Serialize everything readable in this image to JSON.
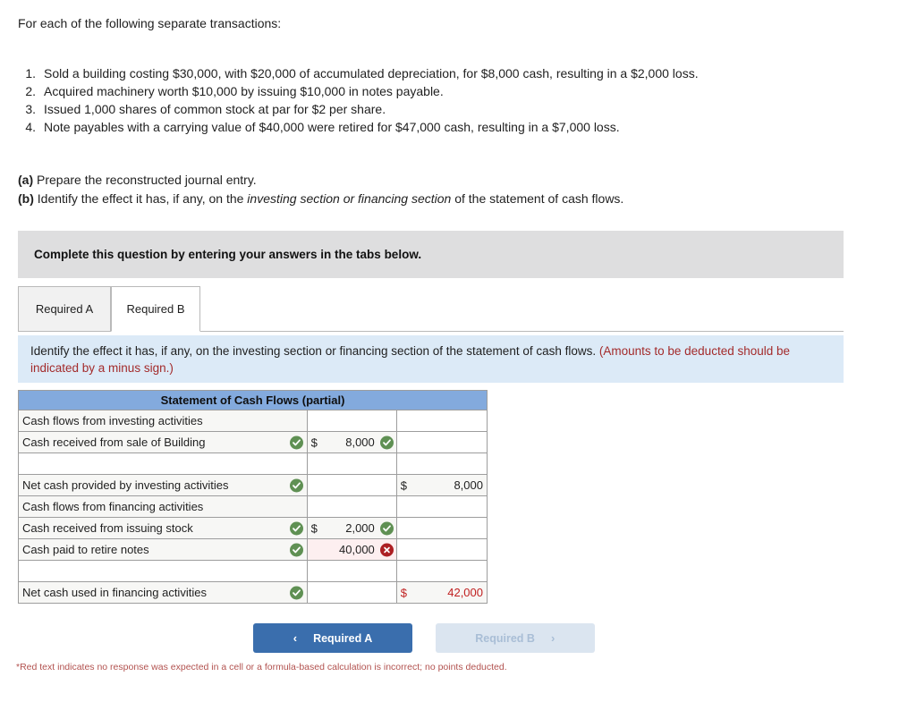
{
  "intro": "For each of the following separate transactions:",
  "transactions": [
    {
      "num": "1.",
      "text": "Sold a building costing $30,000, with $20,000 of accumulated depreciation, for $8,000 cash, resulting in a $2,000 loss."
    },
    {
      "num": "2.",
      "text": "Acquired machinery worth $10,000 by issuing $10,000 in notes payable."
    },
    {
      "num": "3.",
      "text": "Issued 1,000 shares of common stock at par for $2 per share."
    },
    {
      "num": "4.",
      "text": "Note payables with a carrying value of $40,000 were retired for $47,000 cash, resulting in a $7,000 loss."
    }
  ],
  "requirements": {
    "a_label": "(a)",
    "a_text": "Prepare the reconstructed journal entry.",
    "b_label": "(b)",
    "b_text_before": "Identify the effect it has, if any, on the ",
    "b_text_italic": "investing section or financing section",
    "b_text_after": " of the statement of cash flows."
  },
  "banner": {
    "text": "Complete this question by entering your answers in the tabs below."
  },
  "tabs": [
    {
      "label": "Required A",
      "state": "inactive"
    },
    {
      "label": "Required B",
      "state": "active"
    }
  ],
  "instruction_panel": {
    "main": "Identify the effect it has, if any, on the investing section or financing section of the statement of cash flows. ",
    "warning": "(Amounts to be deducted should be indicated by a minus sign.)"
  },
  "statement": {
    "title": "Statement of Cash Flows (partial)",
    "rows": [
      {
        "label": "Cash flows from investing activities",
        "label_mark": "",
        "label_filled": true,
        "col1_dollar": "",
        "col1_value": "",
        "col1_mark": "",
        "col1_state": "empty",
        "col2_dollar": "",
        "col2_value": "",
        "col2_state": "empty"
      },
      {
        "label": "Cash received from sale of Building",
        "label_mark": "ok",
        "label_filled": true,
        "col1_dollar": "$",
        "col1_value": "8,000",
        "col1_mark": "ok",
        "col1_state": "filled",
        "col2_dollar": "",
        "col2_value": "",
        "col2_state": "empty"
      },
      {
        "label": "",
        "label_mark": "",
        "label_filled": false,
        "col1_dollar": "",
        "col1_value": "",
        "col1_mark": "",
        "col1_state": "empty",
        "col2_dollar": "",
        "col2_value": "",
        "col2_state": "empty"
      },
      {
        "label": "Net cash provided by investing activities",
        "label_mark": "ok",
        "label_filled": true,
        "col1_dollar": "",
        "col1_value": "",
        "col1_mark": "",
        "col1_state": "empty",
        "col2_dollar": "$",
        "col2_value": "8,000",
        "col2_state": "filled"
      },
      {
        "label": "Cash flows from financing activities",
        "label_mark": "",
        "label_filled": true,
        "col1_dollar": "",
        "col1_value": "",
        "col1_mark": "",
        "col1_state": "empty",
        "col2_dollar": "",
        "col2_value": "",
        "col2_state": "empty"
      },
      {
        "label": "Cash received from issuing stock",
        "label_mark": "ok",
        "label_filled": true,
        "col1_dollar": "$",
        "col1_value": "2,000",
        "col1_mark": "ok",
        "col1_state": "filled",
        "col2_dollar": "",
        "col2_value": "",
        "col2_state": "empty"
      },
      {
        "label": "Cash paid to retire notes",
        "label_mark": "ok",
        "label_filled": true,
        "col1_dollar": "",
        "col1_value": "40,000",
        "col1_mark": "bad",
        "col1_state": "bad",
        "col2_dollar": "",
        "col2_value": "",
        "col2_state": "empty"
      },
      {
        "label": "",
        "label_mark": "",
        "label_filled": false,
        "col1_dollar": "",
        "col1_value": "",
        "col1_mark": "",
        "col1_state": "empty",
        "col2_dollar": "",
        "col2_value": "",
        "col2_state": "empty"
      },
      {
        "label": "Net cash used in financing activities",
        "label_mark": "ok",
        "label_filled": true,
        "col1_dollar": "",
        "col1_value": "",
        "col1_mark": "",
        "col1_state": "empty",
        "col2_dollar": "$",
        "col2_value": "42,000",
        "col2_state": "red"
      }
    ]
  },
  "nav": {
    "prev_label": "Required A",
    "prev_chevron": "‹",
    "next_label": "Required B",
    "next_chevron": "›"
  },
  "footnote": "*Red text indicates no response was expected in a cell or a formula-based calculation is incorrect; no points deducted.",
  "colors": {
    "header_blue": "#83aadd",
    "panel_blue": "#dceaf7",
    "banner_gray": "#dededf",
    "mark_green": "#5f9053",
    "mark_red": "#ad1f23",
    "warning_red": "#a32b2b",
    "button_blue": "#3a6ead",
    "button_disabled": "#dbe5f0",
    "red_value": "#c02020"
  },
  "icons": {
    "check": "check-icon",
    "cross": "cross-icon",
    "chevron_left": "chevron-left-icon",
    "chevron_right": "chevron-right-icon"
  }
}
